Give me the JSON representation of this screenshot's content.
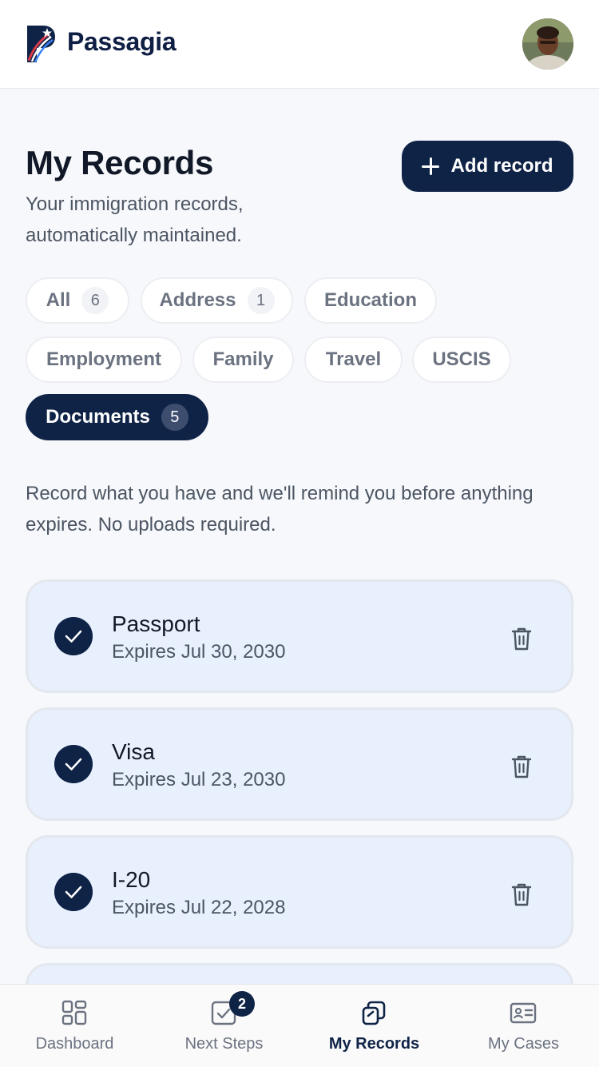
{
  "header": {
    "brand": "Passagia",
    "logo_icon": "passagia-logo-icon",
    "avatar_icon": "user-avatar"
  },
  "main": {
    "title": "My Records",
    "subtitle": "Your immigration records, automatically maintained.",
    "add_button_label": "Add record",
    "info_text": "Record what you have and we'll remind you before anything expires. No uploads required."
  },
  "filters": [
    {
      "label": "All",
      "count": "6",
      "active": false
    },
    {
      "label": "Address",
      "count": "1",
      "active": false
    },
    {
      "label": "Education",
      "count": "",
      "active": false
    },
    {
      "label": "Employment",
      "count": "",
      "active": false
    },
    {
      "label": "Family",
      "count": "",
      "active": false
    },
    {
      "label": "Travel",
      "count": "",
      "active": false
    },
    {
      "label": "USCIS",
      "count": "",
      "active": false
    },
    {
      "label": "Documents",
      "count": "5",
      "active": true
    }
  ],
  "records": [
    {
      "name": "Passport",
      "expires": "Expires Jul 30, 2030"
    },
    {
      "name": "Visa",
      "expires": "Expires Jul 23, 2030"
    },
    {
      "name": "I-20",
      "expires": "Expires Jul 22, 2028"
    }
  ],
  "nav": [
    {
      "label": "Dashboard",
      "icon": "dashboard-icon",
      "active": false
    },
    {
      "label": "Next Steps",
      "icon": "checkbox-icon",
      "active": false,
      "badge": "2"
    },
    {
      "label": "My Records",
      "icon": "records-icon",
      "active": true
    },
    {
      "label": "My Cases",
      "icon": "id-card-icon",
      "active": false
    }
  ],
  "colors": {
    "brand_navy": "#0f2347",
    "card_background": "#e8f0fd",
    "page_background": "#f7f8fb"
  }
}
